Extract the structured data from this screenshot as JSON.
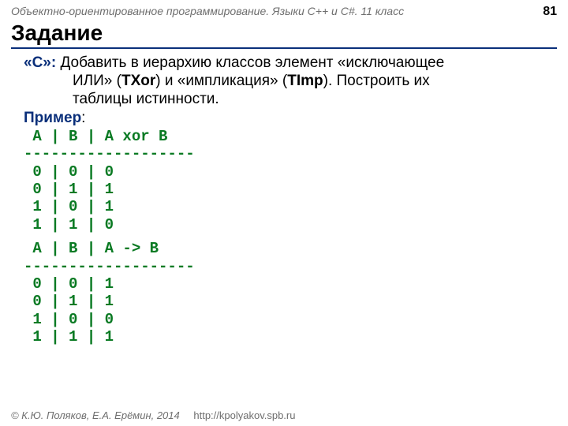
{
  "header": {
    "course": "Объектно-ориентированное программирование. Языки C++ и C#. 11 класс",
    "page": "81"
  },
  "title": "Задание",
  "task": {
    "label": "«С»:",
    "line1": " Добавить в иерархию классов элемент «исключающее",
    "line2_pre": "ИЛИ» (",
    "txor": "TXor",
    "line2_mid": ") и «импликация» (",
    "timp": "TImp",
    "line2_post": "). Построить их",
    "line3": "таблицы истинности."
  },
  "example": {
    "label": "Пример",
    "colon": ":"
  },
  "code1": " A | B | A xor B\n-------------------\n 0 | 0 | 0\n 0 | 1 | 1\n 1 | 0 | 1\n 1 | 1 | 0",
  "code2": " A | B | A -> B\n-------------------\n 0 | 0 | 1\n 0 | 1 | 1\n 1 | 0 | 0\n 1 | 1 | 1",
  "footer": {
    "copyright": "© К.Ю. Поляков, Е.А. Ерёмин, 2014",
    "url": "http://kpolyakov.spb.ru"
  }
}
